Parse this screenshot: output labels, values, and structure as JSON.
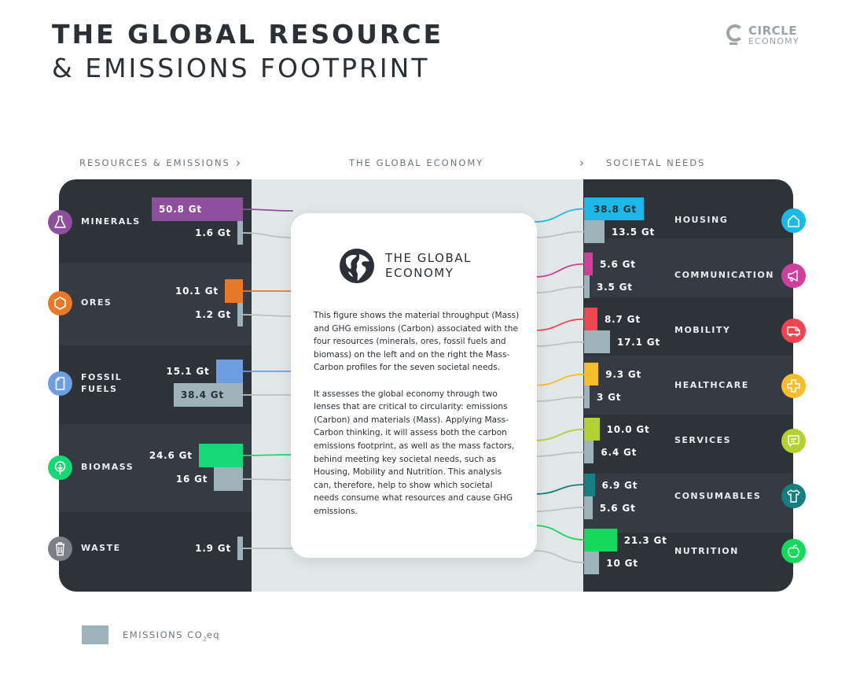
{
  "title": {
    "line1": "THE GLOBAL RESOURCE",
    "line2": "& EMISSIONS FOOTPRINT"
  },
  "logo": {
    "line1": "CIRCLE",
    "line2": "ECONOMY"
  },
  "headers": {
    "left": "RESOURCES & EMISSIONS",
    "middle": "THE GLOBAL ECONOMY",
    "right": "SOCIETAL NEEDS",
    "chevron": "›"
  },
  "card": {
    "title_line1": "THE GLOBAL",
    "title_line2": "ECONOMY",
    "para1": "This figure shows the material throughput (Mass) and GHG emissions (Carbon) associated with the four resources (minerals, ores, fossil fuels and biomass) on the left and on the right the Mass-Carbon profiles for the seven societal needs.",
    "para2": "It assesses the global economy through two lenses that are critical to circularity: emissions (Carbon) and materials (Mass). Applying Mass-Carbon thinking, it will assess both the carbon emissions footprint, as well as the mass factors, behind meeting key societal needs, such as Housing, Mobility and Nutrition. This analysis can, therefore, help to show which societal needs consume what resources and cause GHG emissions."
  },
  "legend": {
    "label": "EMISSIONS CO",
    "sub": "2",
    "suffix": "eq"
  },
  "colors": {
    "emissions": "#9db3ba",
    "panel": "#2d3339"
  },
  "chart_data": {
    "type": "diagram",
    "unit": "Gt",
    "resources": [
      {
        "name": "MINERALS",
        "icon": "flask-icon",
        "color": "#8e4f9f",
        "mass": 50.8,
        "mass_label": "50.8 Gt",
        "emissions": 1.6,
        "emissions_label": "1.6 Gt"
      },
      {
        "name": "ORES",
        "icon": "hexagon-icon",
        "color": "#e8792a",
        "mass": 10.1,
        "mass_label": "10.1 Gt",
        "emissions": 1.2,
        "emissions_label": "1.2 Gt"
      },
      {
        "name": "FOSSIL FUELS",
        "icon": "canister-icon",
        "color": "#6e9de0",
        "mass": 15.1,
        "mass_label": "15.1 Gt",
        "emissions": 38.4,
        "emissions_label": "38.4 Gt"
      },
      {
        "name": "BIOMASS",
        "icon": "leaf-icon",
        "color": "#16d876",
        "mass": 24.6,
        "mass_label": "24.6 Gt",
        "emissions": 16,
        "emissions_label": "16 Gt"
      },
      {
        "name": "WASTE",
        "icon": "trash-icon",
        "color": "#7a8086",
        "mass": null,
        "mass_label": "",
        "emissions": 1.9,
        "emissions_label": "1.9 Gt"
      }
    ],
    "needs": [
      {
        "name": "HOUSING",
        "icon": "house-icon",
        "color": "#1cb8e8",
        "mass": 38.8,
        "mass_label": "38.8 Gt",
        "emissions": 13.5,
        "emissions_label": "13.5 Gt"
      },
      {
        "name": "COMMUNICATION",
        "icon": "megaphone-icon",
        "color": "#d13f9c",
        "mass": 5.6,
        "mass_label": "5.6 Gt",
        "emissions": 3.5,
        "emissions_label": "3.5 Gt"
      },
      {
        "name": "MOBILITY",
        "icon": "van-icon",
        "color": "#ef4550",
        "mass": 8.7,
        "mass_label": "8.7 Gt",
        "emissions": 17.1,
        "emissions_label": "17.1 Gt"
      },
      {
        "name": "HEALTHCARE",
        "icon": "medical-cross-icon",
        "color": "#f8bd2a",
        "mass": 9.3,
        "mass_label": "9.3 Gt",
        "emissions": 3,
        "emissions_label": "3 Gt"
      },
      {
        "name": "SERVICES",
        "icon": "speech-bubble-icon",
        "color": "#b3d232",
        "mass": 10.0,
        "mass_label": "10.0 Gt",
        "emissions": 6.4,
        "emissions_label": "6.4 Gt"
      },
      {
        "name": "CONSUMABLES",
        "icon": "tshirt-icon",
        "color": "#167e80",
        "mass": 6.9,
        "mass_label": "6.9 Gt",
        "emissions": 5.6,
        "emissions_label": "5.6 Gt"
      },
      {
        "name": "NUTRITION",
        "icon": "apple-icon",
        "color": "#16d85a",
        "mass": 21.3,
        "mass_label": "21.3 Gt",
        "emissions": 10,
        "emissions_label": "10 Gt"
      }
    ]
  }
}
